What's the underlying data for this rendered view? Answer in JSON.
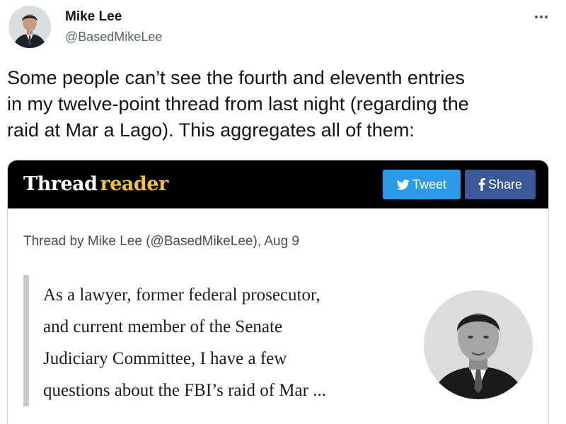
{
  "author": {
    "name": "Mike Lee",
    "handle": "@BasedMikeLee",
    "avatar_icon": "profile-photo"
  },
  "menu": {
    "more_icon": "more-horizontal-icon"
  },
  "tweet": {
    "text": "Some people can’t see the fourth and eleventh entries\nin my twelve-point thread from last night (regarding the\nraid at Mar a Lago).  This aggregates all of them:"
  },
  "card": {
    "brand_first": "Thread",
    "brand_second": "reader",
    "tweet_button": "Tweet",
    "share_button": "Share",
    "byline": "Thread by Mike Lee (@BasedMikeLee), Aug 9",
    "quote": "As a lawyer, former federal prosecutor,\nand current member of the Senate\nJudiciary Committee, I have a few\nquestions about the FBI’s raid of Mar ...",
    "photo_icon": "author-portrait"
  },
  "colors": {
    "header_bg": "#000000",
    "brand_accent": "#f0c23a",
    "tweet_button": "#2b9ae8",
    "share_button": "#3b5998",
    "handle_gray": "#536471"
  }
}
